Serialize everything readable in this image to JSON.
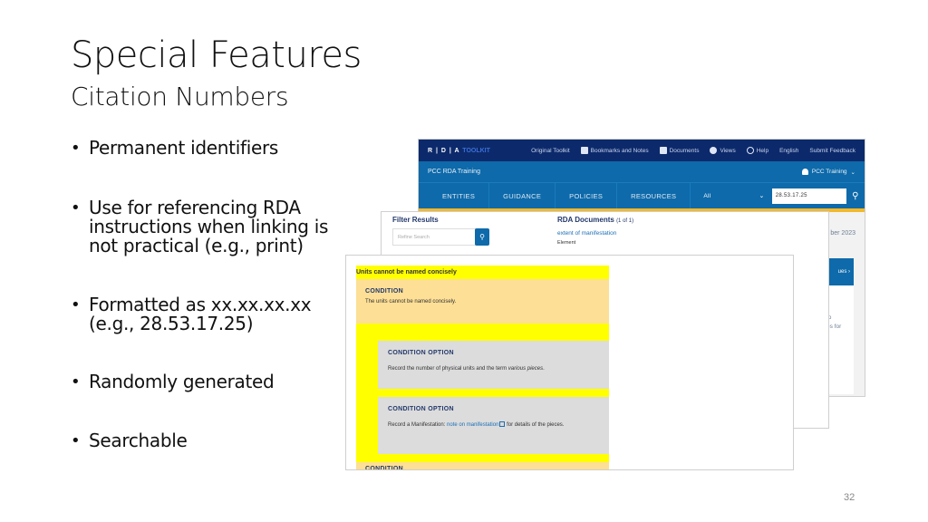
{
  "slide": {
    "title": "Special Features",
    "subtitle": "Citation Numbers",
    "bullets": [
      "Permanent identifiers",
      "Use for referencing RDA instructions when linking is not practical (e.g., print)",
      "Formatted as xx.xx.xx.xx (e.g., 28.53.17.25)",
      "Randomly generated",
      "Searchable"
    ],
    "page_number": "32"
  },
  "toolkit": {
    "logo": "R | D | A",
    "logo_suffix": "TOOLKIT",
    "top_links": [
      "Original Toolkit",
      "Bookmarks and Notes",
      "Documents",
      "Views",
      "Help",
      "English",
      "Submit Feedback"
    ],
    "profile_name": "PCC RDA Training",
    "user_label": "PCC Training",
    "main_nav": [
      "ENTITIES",
      "GUIDANCE",
      "POLICIES",
      "RESOURCES"
    ],
    "search_scope": "All",
    "search_value": "28.53.17.25",
    "date_fragment": "ber 2023",
    "button_fragment": "ues",
    "text_fragment": "to\nes for",
    "colors": {
      "topbar": "#0c2a6b",
      "subbar": "#0e6aaa",
      "accent": "#f3b92c"
    }
  },
  "results": {
    "filter_title": "Filter Results",
    "refine_placeholder": "Refine Search",
    "docs_title": "RDA Documents",
    "docs_count": "(1 of 1)",
    "result_link": "extent of manifestation",
    "result_type": "Element"
  },
  "conditions": {
    "heading": "Units cannot be named concisely",
    "condition_label": "CONDITION",
    "condition_text": "The units cannot be named concisely.",
    "options": [
      {
        "label": "CONDITION OPTION",
        "text_before": "Record the number of physical units and the term ",
        "text_italic": "various pieces",
        "text_after": "."
      },
      {
        "label": "CONDITION OPTION",
        "text_before": "Record a Manifestation: ",
        "link": "note on manifestation",
        "text_after": " for details of the pieces."
      }
    ],
    "next_label": "CONDITION",
    "colors": {
      "highlight": "#ffff00",
      "condition_bg": "#fddf96",
      "option_bg": "#dcdcdc"
    }
  }
}
